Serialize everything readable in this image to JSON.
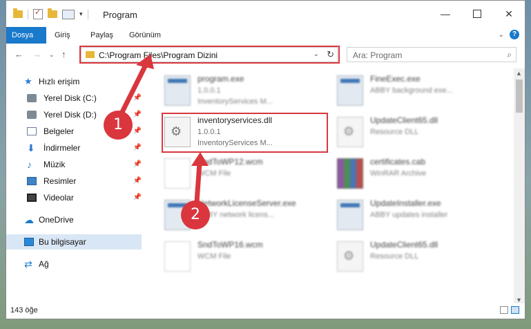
{
  "window": {
    "title": "Program"
  },
  "ribbon": {
    "tabs": [
      "Dosya",
      "Giriş",
      "Paylaş",
      "Görünüm"
    ]
  },
  "nav": {
    "address": "C:\\Program Files\\Program Dizini",
    "search_placeholder": "Ara: Program"
  },
  "sidebar": {
    "quick_access": "Hızlı erişim",
    "items": [
      "Yerel Disk (C:)",
      "Yerel Disk (D:)",
      "Belgeler",
      "İndirmeler",
      "Müzik",
      "Resimler",
      "Videolar"
    ],
    "onedrive": "OneDrive",
    "this_pc": "Bu bilgisayar",
    "network": "Ağ"
  },
  "files": [
    {
      "name": "program.exe",
      "line2": "1.0.0.1",
      "line3": "InventoryServices M...",
      "icon": "exe-icon"
    },
    {
      "name": "FineExec.exe",
      "line2": "ABBY background exe...",
      "line3": "",
      "icon": "exe-icon"
    },
    {
      "name": "inventoryservices.dll",
      "line2": "1.0.0.1",
      "line3": "InventoryServices M...",
      "icon": "dll-icon"
    },
    {
      "name": "UpdateClient65.dll",
      "line2": "Resource DLL",
      "line3": "",
      "icon": "dll-icon"
    },
    {
      "name": "SndToWP12.wcm",
      "line2": "WCM File",
      "line3": "",
      "icon": "file-icon"
    },
    {
      "name": "certificates.cab",
      "line2": "WinRAR Archive",
      "line3": "",
      "icon": "archive-icon"
    },
    {
      "name": "NetworkLicenseServer.exe",
      "line2": "ABBY network licens...",
      "line3": "",
      "icon": "exe-icon"
    },
    {
      "name": "UpdateInstaller.exe",
      "line2": "ABBY updates installer",
      "line3": "",
      "icon": "exe-icon"
    },
    {
      "name": "SndToWP16.wcm",
      "line2": "WCM File",
      "line3": "",
      "icon": "file-icon"
    },
    {
      "name": "UpdateClient65.dll",
      "line2": "Resource DLL",
      "line3": "",
      "icon": "dll-icon"
    }
  ],
  "status": {
    "count": "143 öğe"
  },
  "annotations": [
    "1",
    "2"
  ],
  "colors": {
    "accent": "#1979ca",
    "highlight": "#d9363e"
  }
}
